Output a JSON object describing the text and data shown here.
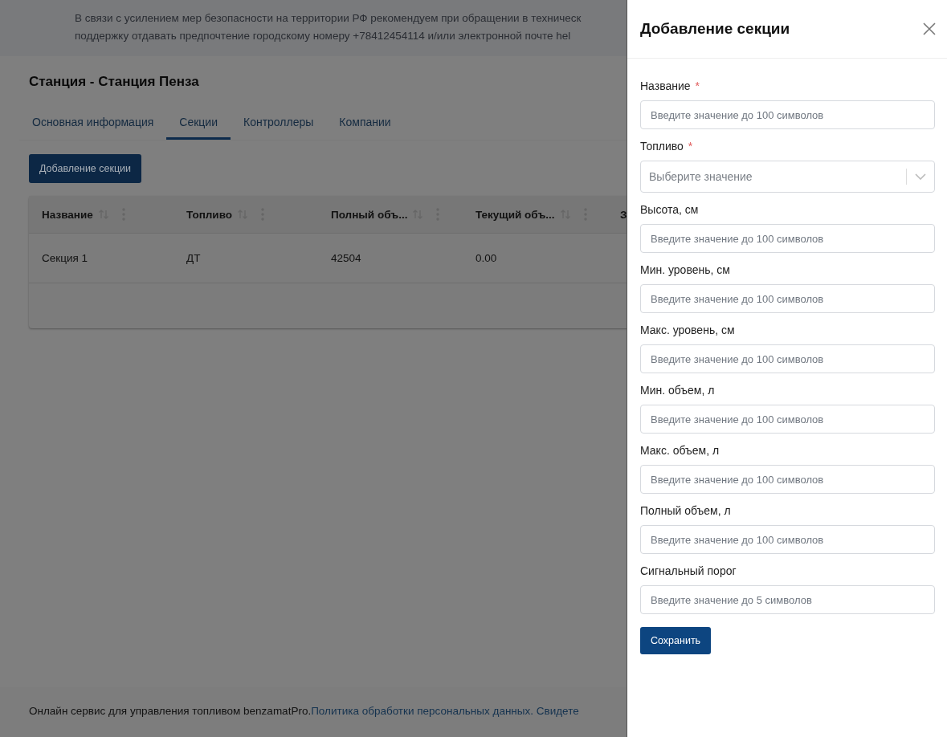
{
  "notice": {
    "lines": [
      "В связи с усилением мер безопасности на территории РФ рекомендуем при обращении в техническ",
      "поддержку отдавать предпочтение городскому номеру +78412454114 и/или электронной почте hel"
    ]
  },
  "page": {
    "title": "Станция - Станция Пенза"
  },
  "tabs": [
    {
      "label": "Основная информация",
      "selected": false
    },
    {
      "label": "Секции",
      "selected": true
    },
    {
      "label": "Контроллеры",
      "selected": false
    },
    {
      "label": "Компании",
      "selected": false
    }
  ],
  "add_button": "Добавление секции",
  "table": {
    "columns": [
      {
        "label": "Название",
        "kind": "sortable"
      },
      {
        "label": "Топливо",
        "kind": "sortable"
      },
      {
        "label": "Полный объ...",
        "kind": "sortable"
      },
      {
        "label": "Текущий объ...",
        "kind": "sortable"
      },
      {
        "label": "З",
        "kind": "plain"
      }
    ],
    "rows": [
      [
        "Секция 1",
        "ДТ",
        "42504",
        "0.00"
      ]
    ]
  },
  "footer": {
    "text": "Онлайн сервис для управления топливом benzamatPro.",
    "link": "Политика обработки персональных данных. Свидете"
  },
  "drawer": {
    "title": "Добавление секции",
    "fields": [
      {
        "kind": "input",
        "label": "Название",
        "required_mark": "*",
        "placeholder": "Введите значение до 100 символов"
      },
      {
        "kind": "select",
        "label": "Топливо",
        "required_mark": "*",
        "placeholder": "Выберите значение"
      },
      {
        "kind": "input",
        "label": "Высота, см",
        "placeholder": "Введите значение до 100 символов"
      },
      {
        "kind": "input",
        "label": "Мин. уровень, см",
        "placeholder": "Введите значение до 100 символов"
      },
      {
        "kind": "input",
        "label": "Макс. уровень, см",
        "placeholder": "Введите значение до 100 символов"
      },
      {
        "kind": "input",
        "label": "Мин. объем, л",
        "placeholder": "Введите значение до 100 символов"
      },
      {
        "kind": "input",
        "label": "Макс. объем, л",
        "placeholder": "Введите значение до 100 символов"
      },
      {
        "kind": "input",
        "label": "Полный объем, л",
        "placeholder": "Введите значение до 100 символов"
      },
      {
        "kind": "input",
        "label": "Сигнальный порог",
        "placeholder": "Введите значение до 5 символов"
      }
    ],
    "save_button": "Сохранить"
  }
}
